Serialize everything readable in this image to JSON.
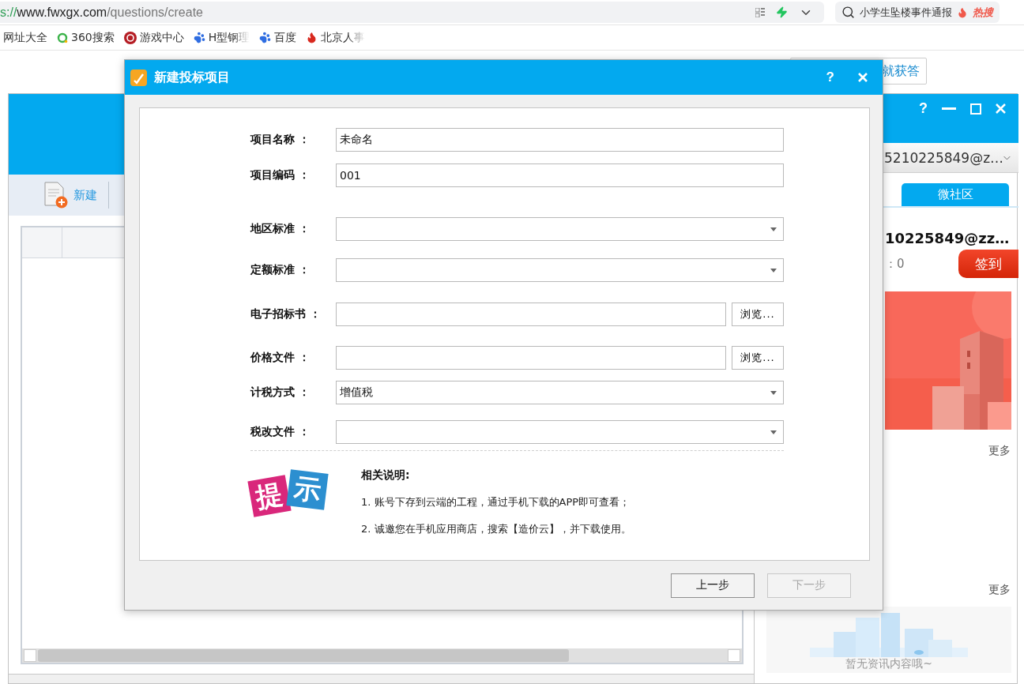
{
  "browser": {
    "url": {
      "scheme": "s://",
      "host": "www.fwxgx.com",
      "path": "/questions/create"
    },
    "search": {
      "value": "小学生坠楼事件通报",
      "hot_label": "热搜"
    },
    "bookmarks": [
      {
        "label": "网址大全",
        "kind": "plain",
        "faded": false
      },
      {
        "label": "360搜索",
        "kind": "ring",
        "faded": false
      },
      {
        "label": "游戏中心",
        "kind": "game",
        "faded": false
      },
      {
        "label": "H型钢理",
        "kind": "paw",
        "faded": true
      },
      {
        "label": "百度",
        "kind": "paw",
        "faded": false
      },
      {
        "label": "北京人事",
        "kind": "flame",
        "faded": true
      }
    ]
  },
  "web_page": {
    "ask_button": "就获答"
  },
  "app": {
    "toolbar": [
      {
        "label": "新建"
      }
    ],
    "help_label": "?",
    "account": "5210225849@z…",
    "community_tab": {
      "label": "微社区",
      "selected": true
    },
    "username": "10225849@zz…",
    "points": "：0",
    "sign_in": "签到",
    "more_links": [
      "更多",
      "更多"
    ],
    "empty_news": "暂无资讯内容哦~"
  },
  "dialog": {
    "title": "新建投标项目",
    "help_label": "?",
    "fields": [
      {
        "label": "项目名称 ：",
        "kind": "text",
        "value": "未命名"
      },
      {
        "label": "项目编码 ：",
        "kind": "text",
        "value": "001"
      },
      {
        "label": "地区标准 ：",
        "kind": "select"
      },
      {
        "label": "定额标准 ：",
        "kind": "select"
      },
      {
        "label": "电子招标书 ：",
        "kind": "file",
        "button": "浏览..."
      },
      {
        "label": "价格文件 ：",
        "kind": "file",
        "button": "浏览..."
      },
      {
        "label": "计税方式 ：",
        "kind": "select",
        "value": "增值税"
      },
      {
        "label": "税改文件 ：",
        "kind": "select"
      }
    ],
    "tips": {
      "logo": [
        "提",
        "示"
      ],
      "heading": "相关说明:",
      "items": [
        "1.  账号下存到云端的工程，通过手机下载的APP即可查看；",
        "2.  诚邀您在手机应用商店，搜索【造价云】，并下载使用。"
      ]
    },
    "buttons": [
      {
        "label": "上一步",
        "disabled": false
      },
      {
        "label": "下一步",
        "disabled": true
      }
    ]
  }
}
